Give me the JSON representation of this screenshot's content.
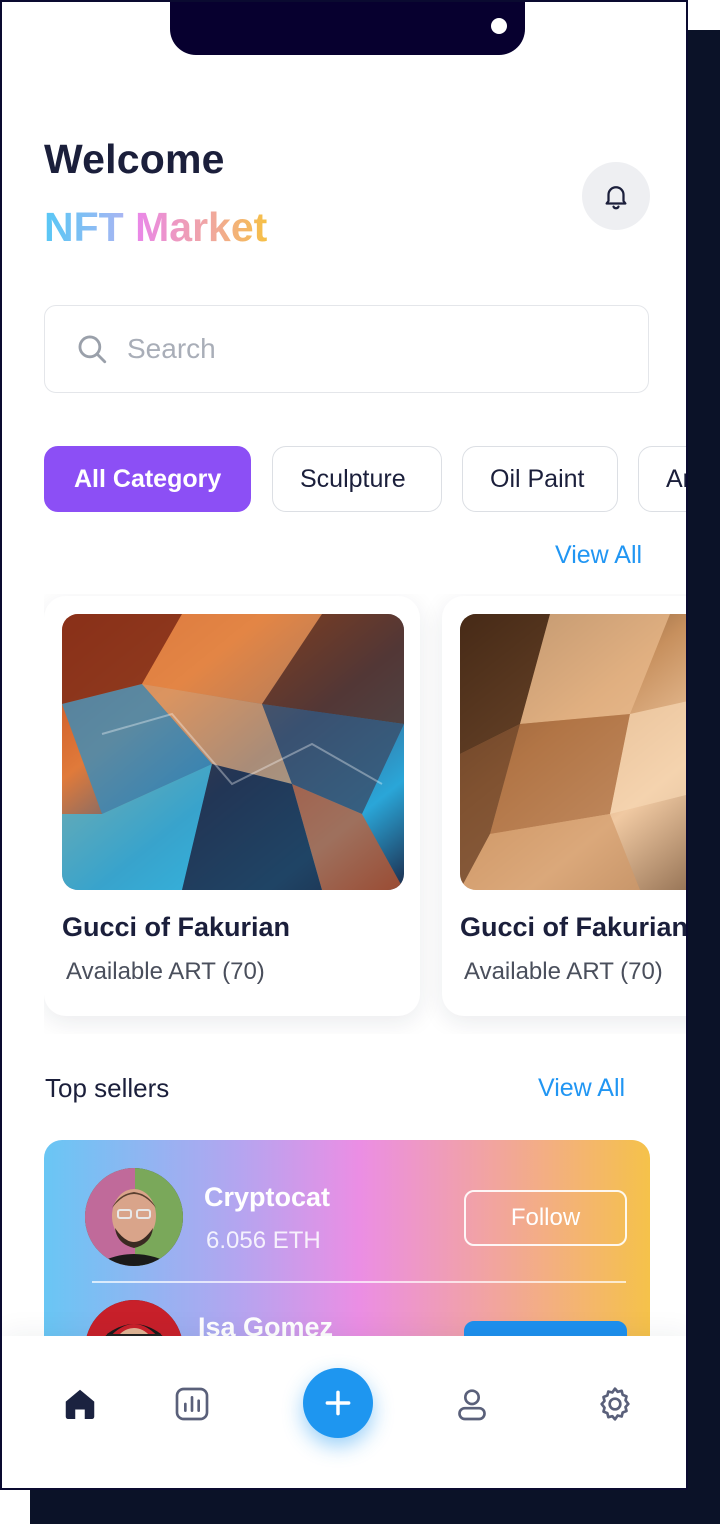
{
  "header": {
    "title": "Welcome",
    "subtitle_part1": "NFT",
    "subtitle_part2": "Market",
    "notification_icon": "bell-icon"
  },
  "search": {
    "placeholder": "Search",
    "value": "",
    "icon": "search-icon"
  },
  "categories": [
    {
      "label": "All Category",
      "active": true
    },
    {
      "label": "Sculpture",
      "active": false
    },
    {
      "label": "Oil Paint",
      "active": false
    },
    {
      "label": "Ar",
      "active": false
    }
  ],
  "featured": {
    "view_all_label": "View All",
    "items": [
      {
        "title": "Gucci of Fakurian",
        "subtitle": "Available ART (70)",
        "image": "holographic-foil-art"
      },
      {
        "title": "Gucci of Fakurian",
        "subtitle": "Available ART (70)",
        "image": "gold-foil-art"
      }
    ]
  },
  "top_sellers": {
    "title": "Top sellers",
    "view_all_label": "View All",
    "items": [
      {
        "name": "Cryptocat",
        "eth": "6.056 ETH",
        "button_label": "Follow"
      },
      {
        "name": "Isa Gomez",
        "eth": "",
        "button_label": ""
      }
    ]
  },
  "bottom_nav": {
    "items": [
      "home-icon",
      "stats-icon",
      "add-icon",
      "profile-icon",
      "settings-icon"
    ],
    "active": "home-icon"
  },
  "colors": {
    "primary_purple": "#8c4ff5",
    "accent_blue": "#2196f3",
    "dark_text": "#1b1f3b",
    "notch": "#07002f"
  }
}
